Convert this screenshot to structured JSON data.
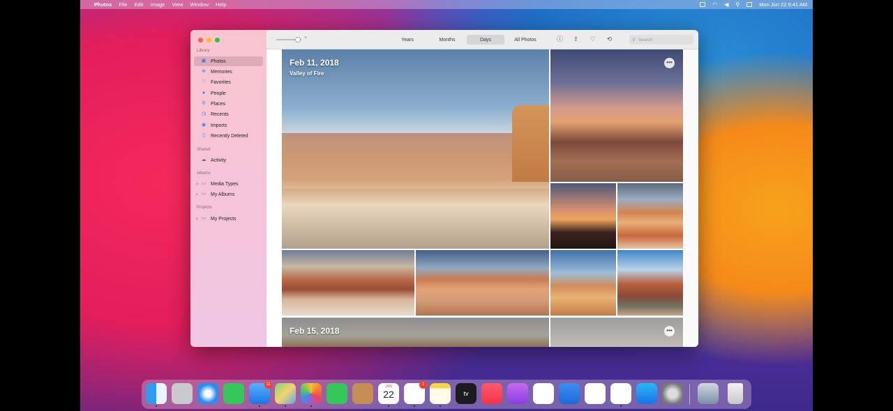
{
  "menubar": {
    "apple": "",
    "app_name": "Photos",
    "menus": [
      "File",
      "Edit",
      "Image",
      "View",
      "Window",
      "Help"
    ],
    "clock": "Mon Jun 22  9:41 AM"
  },
  "sidebar": {
    "library_label": "Library",
    "library_items": [
      "Photos",
      "Memories",
      "Favorites",
      "People",
      "Places",
      "Recents",
      "Imports",
      "Recently Deleted"
    ],
    "shared_label": "Shared",
    "shared_items": [
      "Activity"
    ],
    "albums_label": "Albums",
    "album_items": [
      "Media Types",
      "My Albums"
    ],
    "projects_label": "Projects",
    "project_items": [
      "My Projects"
    ]
  },
  "toolbar": {
    "tabs": [
      "Years",
      "Months",
      "Days",
      "All Photos"
    ],
    "active_tab": "Days",
    "search_placeholder": "Search"
  },
  "content": {
    "groups": [
      {
        "date": "Feb 11, 2018",
        "place": "Valley of Fire"
      },
      {
        "date": "Feb 15, 2018",
        "place": ""
      }
    ]
  },
  "dock": {
    "calendar_month": "JUN",
    "calendar_day": "22",
    "mail_badge": "11",
    "reminders_badge": "1",
    "tv_label": "tv"
  }
}
